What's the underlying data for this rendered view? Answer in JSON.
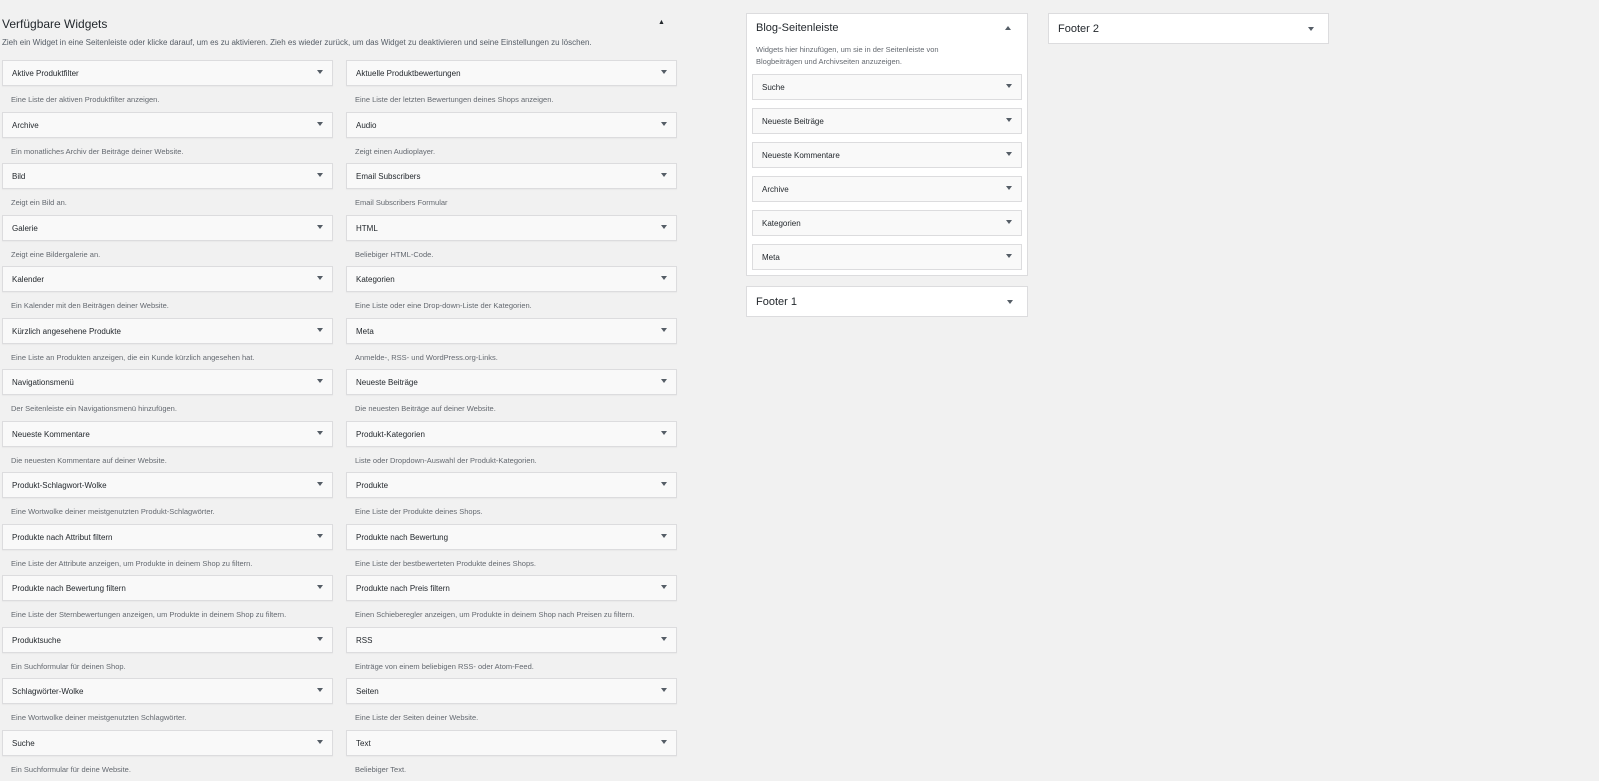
{
  "available": {
    "title": "Verfügbare Widgets",
    "description": "Zieh ein Widget in eine Seitenleiste oder klicke darauf, um es zu aktivieren. Zieh es wieder zurück, um das Widget zu deaktivieren und seine Einstellungen zu löschen.",
    "toggle": "▲",
    "widgets": [
      {
        "title": "Aktive Produktfilter",
        "desc": "Eine Liste der aktiven Produktfilter anzeigen."
      },
      {
        "title": "Aktuelle Produktbewertungen",
        "desc": "Eine Liste der letzten Bewertungen deines Shops anzeigen."
      },
      {
        "title": "Archive",
        "desc": "Ein monatliches Archiv der Beiträge deiner Website."
      },
      {
        "title": "Audio",
        "desc": "Zeigt einen Audioplayer."
      },
      {
        "title": "Bild",
        "desc": "Zeigt ein Bild an."
      },
      {
        "title": "Email Subscribers",
        "desc": "Email Subscribers Formular"
      },
      {
        "title": "Galerie",
        "desc": "Zeigt eine Bildergalerie an."
      },
      {
        "title": "HTML",
        "desc": "Beliebiger HTML-Code."
      },
      {
        "title": "Kalender",
        "desc": "Ein Kalender mit den Beiträgen deiner Website."
      },
      {
        "title": "Kategorien",
        "desc": "Eine Liste oder eine Drop-down-Liste der Kategorien."
      },
      {
        "title": "Kürzlich angesehene Produkte",
        "desc": "Eine Liste an Produkten anzeigen, die ein Kunde kürzlich angesehen hat."
      },
      {
        "title": "Meta",
        "desc": "Anmelde-, RSS- und WordPress.org-Links."
      },
      {
        "title": "Navigationsmenü",
        "desc": "Der Seitenleiste ein Navigationsmenü hinzufügen."
      },
      {
        "title": "Neueste Beiträge",
        "desc": "Die neuesten Beiträge auf deiner Website."
      },
      {
        "title": "Neueste Kommentare",
        "desc": "Die neuesten Kommentare auf deiner Website."
      },
      {
        "title": "Produkt-Kategorien",
        "desc": "Liste oder Dropdown-Auswahl der Produkt-Kategorien."
      },
      {
        "title": "Produkt-Schlagwort-Wolke",
        "desc": "Eine Wortwolke deiner meistgenutzten Produkt-Schlagwörter."
      },
      {
        "title": "Produkte",
        "desc": "Eine Liste der Produkte deines Shops."
      },
      {
        "title": "Produkte nach Attribut filtern",
        "desc": "Eine Liste der Attribute anzeigen, um Produkte in deinem Shop zu filtern."
      },
      {
        "title": "Produkte nach Bewertung",
        "desc": "Eine Liste der bestbewerteten Produkte deines Shops."
      },
      {
        "title": "Produkte nach Bewertung filtern",
        "desc": "Eine Liste der Sternbewertungen anzeigen, um Produkte in deinem Shop zu filtern."
      },
      {
        "title": "Produkte nach Preis filtern",
        "desc": "Einen Schieberegler anzeigen, um Produkte in deinem Shop nach Preisen zu filtern."
      },
      {
        "title": "Produktsuche",
        "desc": "Ein Suchformular für deinen Shop."
      },
      {
        "title": "RSS",
        "desc": "Einträge von einem beliebigen RSS- oder Atom-Feed."
      },
      {
        "title": "Schlagwörter-Wolke",
        "desc": "Eine Wortwolke deiner meistgenutzten Schlagwörter."
      },
      {
        "title": "Seiten",
        "desc": "Eine Liste der Seiten deiner Website."
      },
      {
        "title": "Suche",
        "desc": "Ein Suchformular für deine Website."
      },
      {
        "title": "Text",
        "desc": "Beliebiger Text."
      }
    ]
  },
  "blog_sidebar": {
    "title": "Blog-Seitenleiste",
    "description": "Widgets hier hinzufügen, um sie in der Seitenleiste von Blogbeiträgen und Archivseiten anzuzeigen.",
    "items": [
      "Suche",
      "Neueste Beiträge",
      "Neueste Kommentare",
      "Archive",
      "Kategorien",
      "Meta"
    ]
  },
  "footer1": {
    "title": "Footer 1"
  },
  "footer2": {
    "title": "Footer 2"
  }
}
